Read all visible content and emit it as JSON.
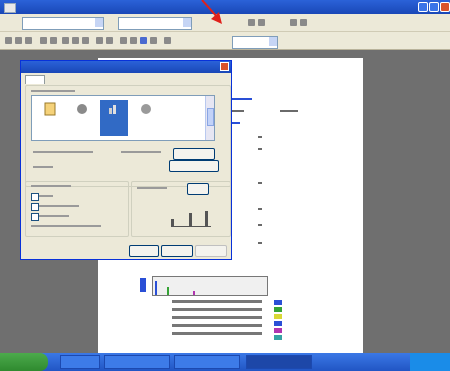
{
  "app": {
    "title": "",
    "taskbar_start_label": "",
    "taskbar_items": [
      "",
      "",
      "",
      ""
    ]
  },
  "toolbar": {
    "font_name": "",
    "font_size": "",
    "zoom": ""
  },
  "dialog": {
    "title": "",
    "tab_label": "",
    "ok_label": "",
    "cancel_label": "",
    "help_label": ""
  },
  "colors": {
    "xp_blue": "#1947b7",
    "dialog_bg": "#ece9d8",
    "workspace": "#6f6f6f",
    "arrow": "#e0201a"
  },
  "icons": [
    "red-arrow-icon",
    "document-icon",
    "globe-icon",
    "chart-icon",
    "close-icon",
    "windows-logo-icon"
  ]
}
